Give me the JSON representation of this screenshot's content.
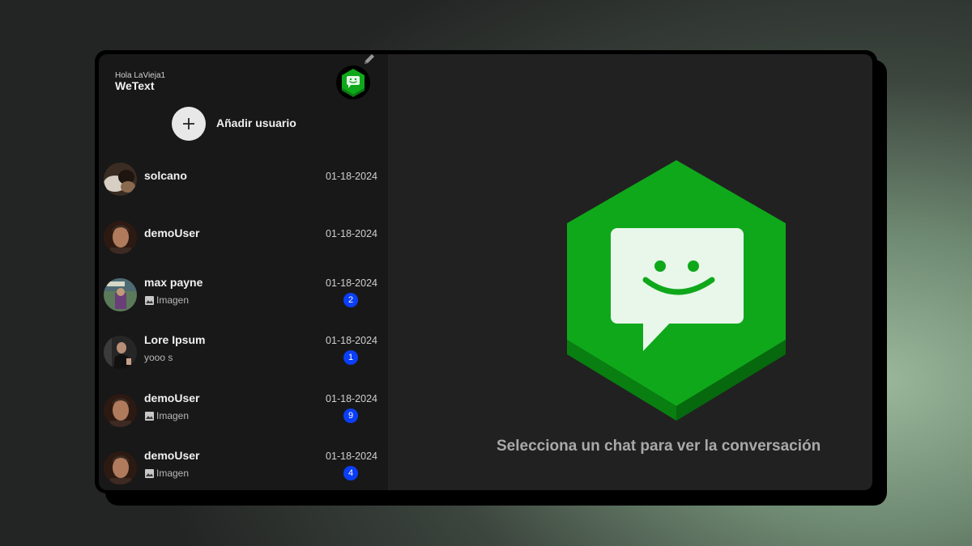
{
  "sidebar": {
    "greeting": "Hola LaVieja1",
    "app_title": "WeText",
    "add_user_label": "Añadir usuario",
    "chats": [
      {
        "name": "solcano",
        "date": "01-18-2024",
        "preview": "",
        "unread": ""
      },
      {
        "name": "demoUser",
        "date": "01-18-2024",
        "preview": "",
        "unread": ""
      },
      {
        "name": "max payne",
        "date": "01-18-2024",
        "preview": "Imagen",
        "unread": "2"
      },
      {
        "name": "Lore Ipsum",
        "date": "01-18-2024",
        "preview": "yooo s",
        "unread": "1"
      },
      {
        "name": "demoUser",
        "date": "01-18-2024",
        "preview": "Imagen",
        "unread": "9"
      },
      {
        "name": "demoUser",
        "date": "01-18-2024",
        "preview": "Imagen",
        "unread": "4"
      }
    ]
  },
  "main": {
    "empty_state_text": "Selecciona un chat para ver la conversación"
  },
  "icons": {
    "logo": "chat-hexagon-logo",
    "edit": "pencil-icon",
    "add": "plus-icon",
    "image": "image-icon"
  },
  "colors": {
    "brand_green": "#0fa81b",
    "badge_blue": "#0b3ef7",
    "sidebar_bg": "#181818",
    "main_bg": "#212121"
  }
}
